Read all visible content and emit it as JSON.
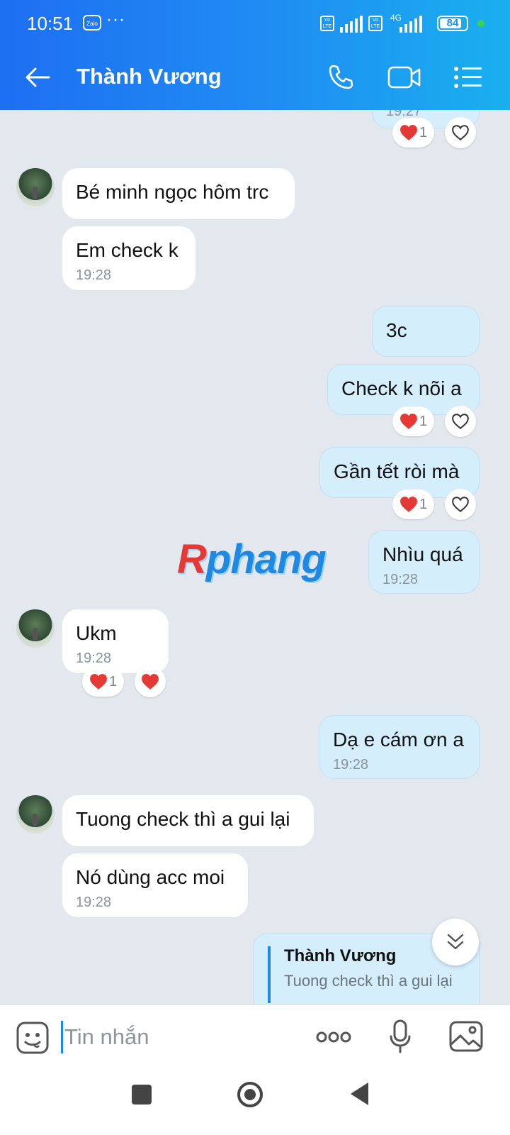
{
  "status_bar": {
    "time": "10:51",
    "app_badge": "Zalo",
    "more": "···",
    "volte_1": "Vo LTE",
    "volte_2": "Vo LTE",
    "network": "4G",
    "battery": "84"
  },
  "header": {
    "back_icon": "arrow-left-icon",
    "contact_name": "Thành Vương",
    "call_icon": "phone-icon",
    "video_icon": "video-camera-icon",
    "menu_icon": "list-menu-icon"
  },
  "messages": [
    {
      "side": "out",
      "time": "19:27",
      "reactions": {
        "count": "1"
      }
    },
    {
      "side": "in",
      "text": "Bé minh ngọc hôm trc"
    },
    {
      "side": "in",
      "text": "Em check k",
      "time": "19:28"
    },
    {
      "side": "out",
      "text": "3c"
    },
    {
      "side": "out",
      "text": "Check k nõi a",
      "reactions": {
        "count": "1"
      }
    },
    {
      "side": "out",
      "text": "Gần tết ròi mà",
      "reactions": {
        "count": "1"
      }
    },
    {
      "side": "out",
      "text": "Nhìu quá",
      "time": "19:28"
    },
    {
      "side": "in",
      "text": "Ukm",
      "time": "19:28",
      "reactions": {
        "count": "1"
      }
    },
    {
      "side": "out",
      "text": "Dạ e cám ơn a",
      "time": "19:28"
    },
    {
      "side": "in",
      "text": "Tuong check thì a gui lại"
    },
    {
      "side": "in",
      "text": "Nó dùng acc moi",
      "time": "19:28"
    }
  ],
  "quoted_reply": {
    "name": "Thành Vương",
    "text": "Tuong check thì a gui lại"
  },
  "watermark": "Rphang",
  "input": {
    "placeholder": "Tin nhắn",
    "value": "",
    "sticker_icon": "sticker-face-icon",
    "more_icon": "more-dots-icon",
    "mic_icon": "microphone-icon",
    "image_icon": "image-gallery-icon"
  },
  "nav": {
    "recent_icon": "square-recent-apps-icon",
    "home_icon": "circle-home-icon",
    "back_icon": "triangle-back-icon"
  },
  "colors": {
    "header_start": "#1e6ff2",
    "header_end": "#19b0ee",
    "chat_bg": "#e2e8ee",
    "incoming_bubble": "#ffffff",
    "outgoing_bubble": "#d5eefc",
    "heart": "#e53935",
    "accent": "#1e88e5"
  }
}
